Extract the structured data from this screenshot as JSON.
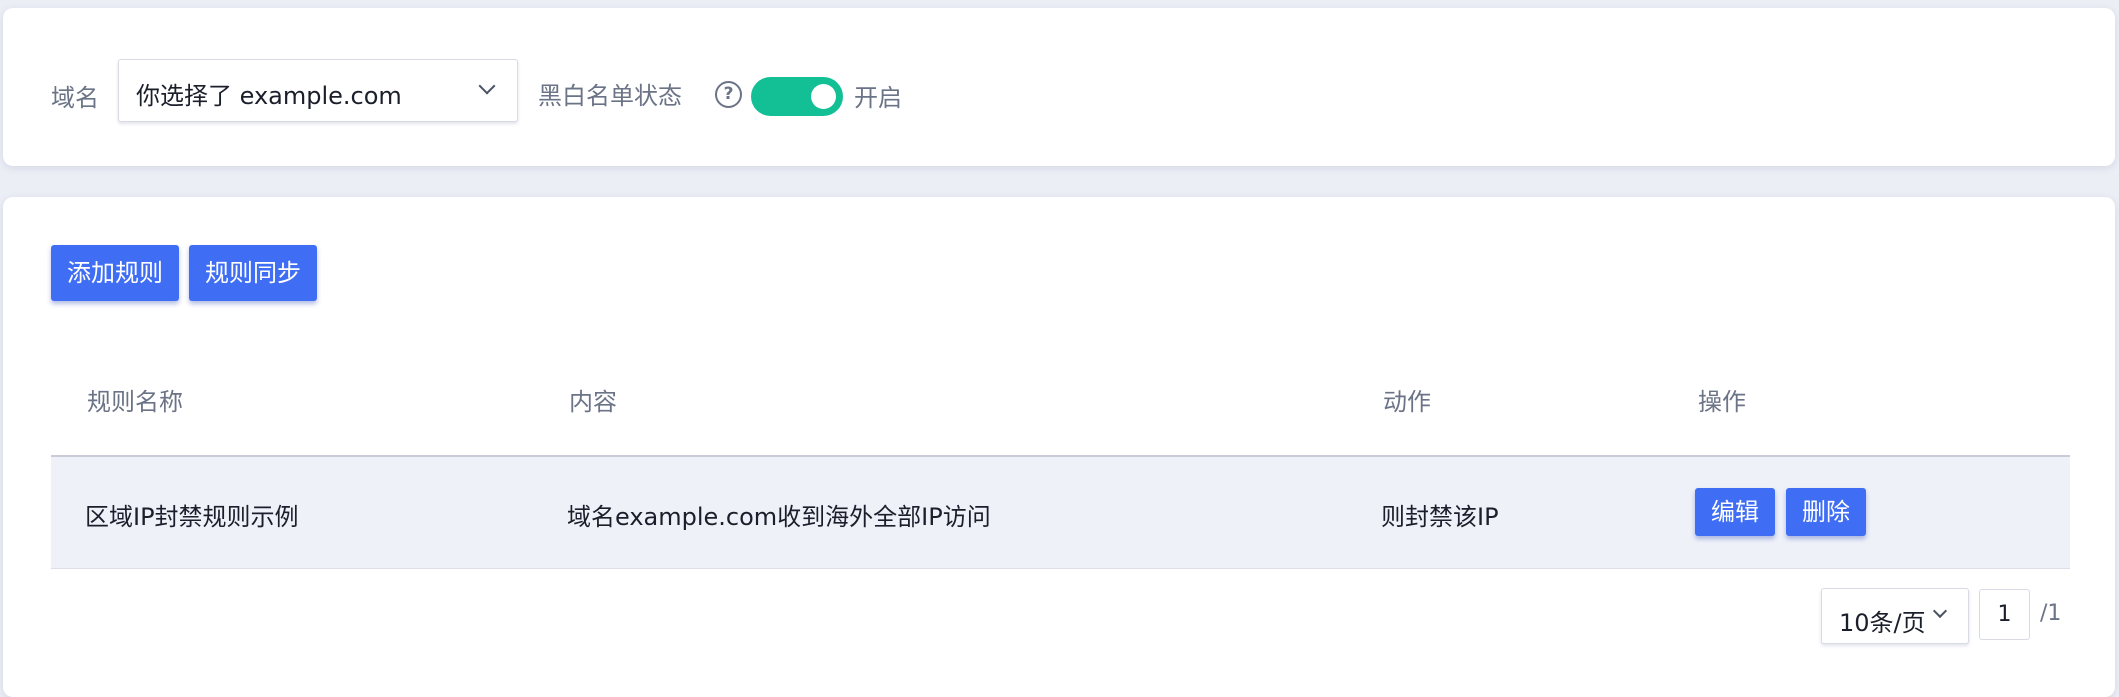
{
  "filter": {
    "domain_label": "域名",
    "domain_value": "你选择了 example.com",
    "status_label": "黑白名单状态",
    "help_icon": "question-circle-icon",
    "toggle_on": true,
    "toggle_color": "#13bf95",
    "toggle_text": "开启"
  },
  "toolbar": {
    "add_label": "添加规则",
    "sync_label": "规则同步",
    "accent": "#3f6ef5"
  },
  "table": {
    "columns": [
      "规则名称",
      "内容",
      "动作",
      "操作"
    ],
    "rows": [
      {
        "name": "区域IP封禁规则示例",
        "content": "域名example.com收到海外全部IP访问",
        "action": "则封禁该IP",
        "edit_label": "编辑",
        "delete_label": "删除"
      }
    ]
  },
  "pagination": {
    "page_size": "10条/页",
    "current_page": "1",
    "total": "/1"
  }
}
